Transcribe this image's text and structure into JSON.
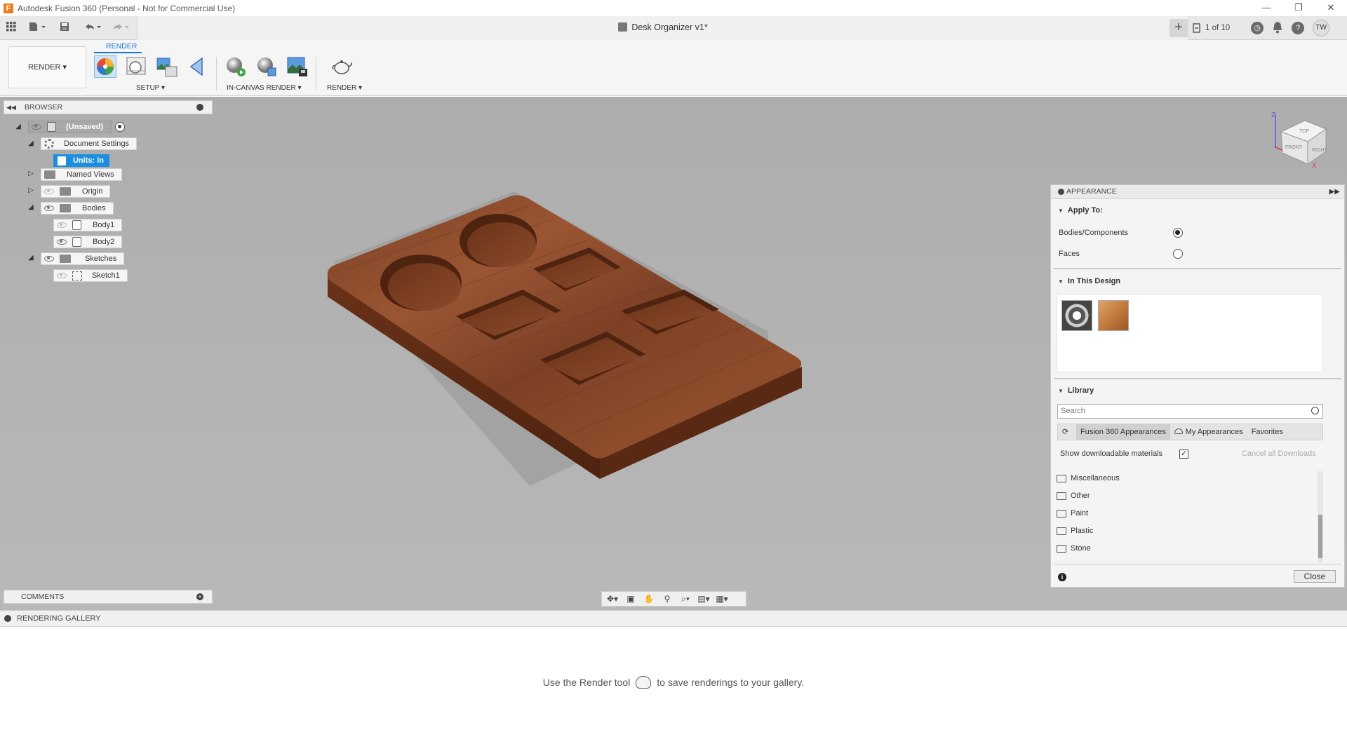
{
  "window": {
    "title": "Autodesk Fusion 360 (Personal - Not for Commercial Use)",
    "logo": "F",
    "controls": {
      "minimize": "—",
      "restore": "❐",
      "close": "✕"
    }
  },
  "tabbar": {
    "document_title": "Desk Organizer v1*",
    "close_glyph": "✕",
    "plus_glyph": "+",
    "job_status": "1 of 10",
    "clock_glyph": "◷",
    "help_glyph": "?",
    "user_initials": "TW"
  },
  "ribbon": {
    "workspace": "RENDER ▾",
    "active_tab": "RENDER",
    "groups": {
      "setup": "SETUP ▾",
      "in_canvas_render": "IN-CANVAS RENDER ▾",
      "render": "RENDER ▾"
    }
  },
  "browser": {
    "header": "BROWSER",
    "items": [
      {
        "label": "(Unsaved)"
      },
      {
        "label": "Document Settings"
      },
      {
        "label": "Units: in"
      },
      {
        "label": "Named Views"
      },
      {
        "label": "Origin"
      },
      {
        "label": "Bodies"
      },
      {
        "label": "Body1"
      },
      {
        "label": "Body2"
      },
      {
        "label": "Sketches"
      },
      {
        "label": "Sketch1"
      }
    ]
  },
  "comments": {
    "header": "COMMENTS"
  },
  "viewcube": {
    "top": "TOP",
    "front": "FRONT",
    "right": "RIGHT",
    "axis_x": "X",
    "axis_z": "Z"
  },
  "appearance": {
    "header": "APPEARANCE",
    "apply_to": {
      "title": "Apply To:",
      "options": [
        "Bodies/Components",
        "Faces"
      ],
      "selected": "Bodies/Components"
    },
    "in_this_design": {
      "title": "In This Design"
    },
    "library": {
      "title": "Library",
      "search_placeholder": "Search",
      "tabs": [
        "Fusion 360 Appearances",
        "My Appearances",
        "Favorites"
      ],
      "active_tab": "Fusion 360 Appearances",
      "show_downloadable": "Show downloadable materials",
      "show_downloadable_checked": true,
      "cancel_downloads": "Cancel all Downloads",
      "folders": [
        "Miscellaneous",
        "Other",
        "Paint",
        "Plastic",
        "Stone"
      ]
    },
    "info_glyph": "i",
    "close_label": "Close"
  },
  "gallery": {
    "header": "RENDERING GALLERY",
    "message_before": "Use the Render tool",
    "message_after": "to save renderings to your gallery."
  },
  "colors": {
    "accent": "#1a8ee0",
    "wood": "#8a4a2a",
    "canvas_bg": "#b0b0b0"
  }
}
